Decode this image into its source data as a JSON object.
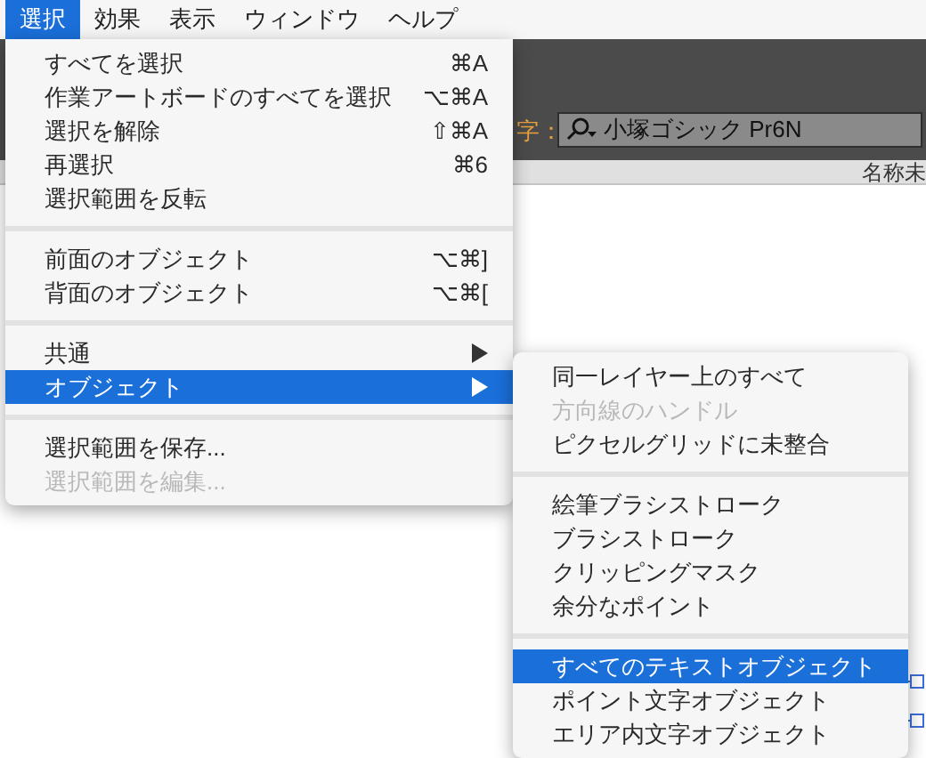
{
  "menu_bar": [
    {
      "label": "選択",
      "selected": true
    },
    {
      "label": "効果",
      "selected": false
    },
    {
      "label": "表示",
      "selected": false
    },
    {
      "label": "ウィンドウ",
      "selected": false
    },
    {
      "label": "ヘルプ",
      "selected": false
    }
  ],
  "toolbar": {
    "char_label": "字：",
    "font_field": {
      "value": "小塚ゴシック Pr6N"
    }
  },
  "document_tab": {
    "title": "名称未"
  },
  "menu": [
    {
      "kind": "item",
      "label": "すべてを選択",
      "shortcut": "⌘A",
      "selected": false,
      "disabled": false
    },
    {
      "kind": "item",
      "label": "作業アートボードのすべてを選択",
      "shortcut": "⌥⌘A",
      "selected": false,
      "disabled": false
    },
    {
      "kind": "item",
      "label": "選択を解除",
      "shortcut": "⇧⌘A",
      "selected": false,
      "disabled": false
    },
    {
      "kind": "item",
      "label": "再選択",
      "shortcut": "⌘6",
      "selected": false,
      "disabled": false
    },
    {
      "kind": "item",
      "label": "選択範囲を反転",
      "selected": false,
      "disabled": false
    },
    {
      "kind": "separator"
    },
    {
      "kind": "item",
      "label": "前面のオブジェクト",
      "shortcut": "⌥⌘]",
      "selected": false,
      "disabled": false
    },
    {
      "kind": "item",
      "label": "背面のオブジェクト",
      "shortcut": "⌥⌘[",
      "selected": false,
      "disabled": false
    },
    {
      "kind": "separator"
    },
    {
      "kind": "submenu",
      "label": "共通",
      "selected": false,
      "disabled": false
    },
    {
      "kind": "submenu",
      "label": "オブジェクト",
      "selected": true,
      "disabled": false
    },
    {
      "kind": "separator"
    },
    {
      "kind": "item",
      "label": "選択範囲を保存...",
      "selected": false,
      "disabled": false
    },
    {
      "kind": "item",
      "label": "選択範囲を編集...",
      "selected": false,
      "disabled": true
    }
  ],
  "submenu": [
    {
      "kind": "item",
      "label": "同一レイヤー上のすべて",
      "selected": false,
      "disabled": false
    },
    {
      "kind": "item",
      "label": "方向線のハンドル",
      "selected": false,
      "disabled": true
    },
    {
      "kind": "item",
      "label": "ピクセルグリッドに未整合",
      "selected": false,
      "disabled": false
    },
    {
      "kind": "separator"
    },
    {
      "kind": "item",
      "label": "絵筆ブラシストローク",
      "selected": false,
      "disabled": false
    },
    {
      "kind": "item",
      "label": "ブラシストローク",
      "selected": false,
      "disabled": false
    },
    {
      "kind": "item",
      "label": "クリッピングマスク",
      "selected": false,
      "disabled": false
    },
    {
      "kind": "item",
      "label": "余分なポイント",
      "selected": false,
      "disabled": false
    },
    {
      "kind": "separator"
    },
    {
      "kind": "item",
      "label": "すべてのテキストオブジェクト",
      "selected": true,
      "disabled": false
    },
    {
      "kind": "item",
      "label": "ポイント文字オブジェクト",
      "selected": false,
      "disabled": false
    },
    {
      "kind": "item",
      "label": "エリア内文字オブジェクト",
      "selected": false,
      "disabled": false
    }
  ]
}
